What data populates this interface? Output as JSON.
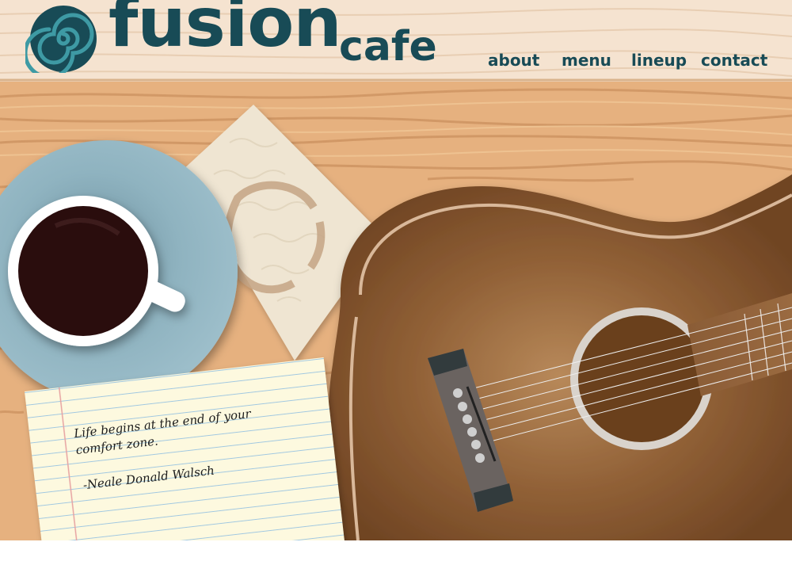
{
  "brand": {
    "name_main": "fusion",
    "name_sub": "cafe"
  },
  "nav": {
    "items": [
      {
        "label": "about"
      },
      {
        "label": "menu"
      },
      {
        "label": "lineup"
      },
      {
        "label": "contact"
      }
    ]
  },
  "note": {
    "quote": "Life begins at the end of your comfort zone.",
    "author": "-Neale Donald Walsch"
  },
  "colors": {
    "brand_teal": "#184b56",
    "header_wood": "#f5e3d0",
    "table_wood": "#e6b17f",
    "saucer": "#8fb3c0",
    "coffee": "#2a0e10",
    "guitar_body": "#8a5a33"
  }
}
